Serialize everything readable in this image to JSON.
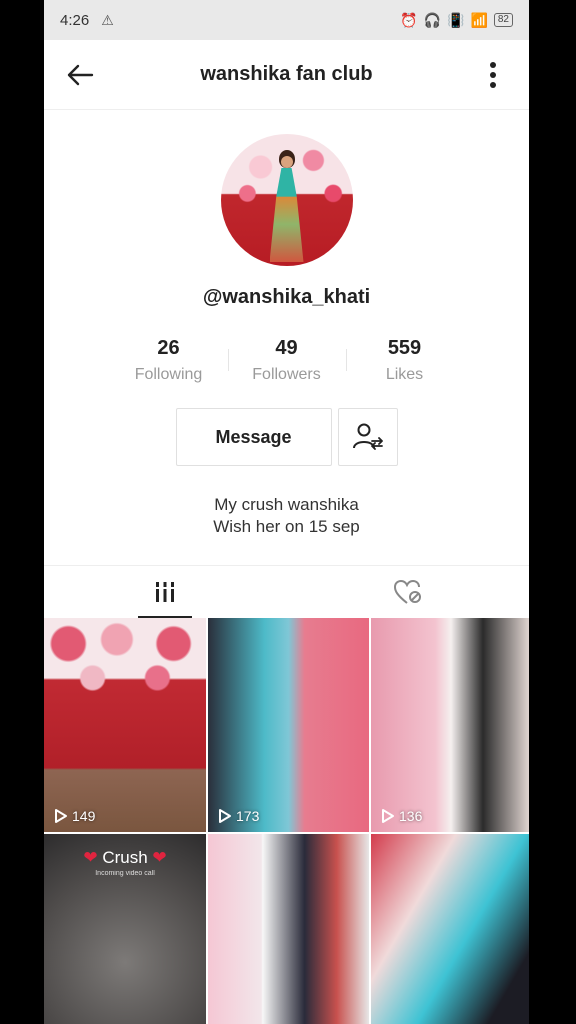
{
  "status_bar": {
    "time": "4:26",
    "battery": "82"
  },
  "header": {
    "title": "wanshika fan club"
  },
  "profile": {
    "username": "@wanshika_khati",
    "stats": [
      {
        "value": "26",
        "label": "Following"
      },
      {
        "value": "49",
        "label": "Followers"
      },
      {
        "value": "559",
        "label": "Likes"
      }
    ],
    "message_label": "Message",
    "bio_line1": "My crush wanshika",
    "bio_line2": "Wish her on 15 sep"
  },
  "videos": [
    {
      "views": "149"
    },
    {
      "views": "173"
    },
    {
      "views": "136"
    },
    {
      "caption": "Crush",
      "subcaption": "Incoming video call"
    },
    {},
    {}
  ]
}
